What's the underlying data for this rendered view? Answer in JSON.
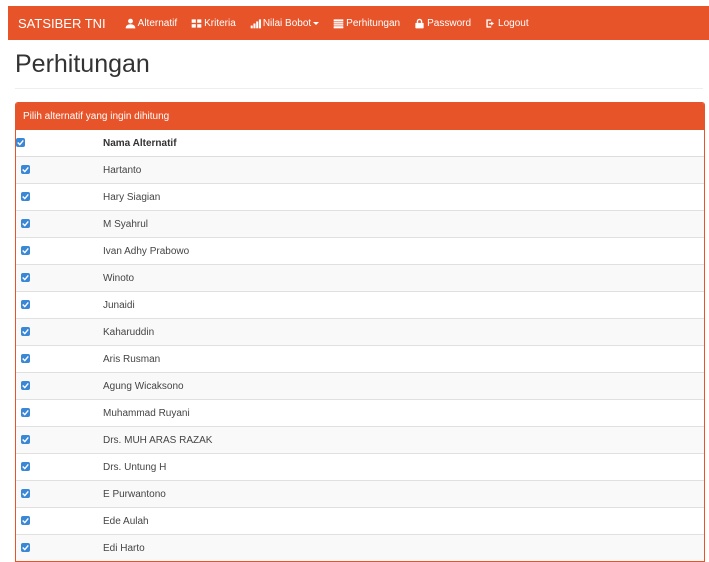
{
  "navbar": {
    "brand": "SATSIBER TNI",
    "items": [
      {
        "label": "Alternatif",
        "icon": "user-icon"
      },
      {
        "label": "Kriteria",
        "icon": "th-large-icon"
      },
      {
        "label": "Nilai Bobot",
        "icon": "signal-icon",
        "dropdown": true
      },
      {
        "label": "Perhitungan",
        "icon": "calendar-icon"
      },
      {
        "label": "Password",
        "icon": "lock-icon"
      },
      {
        "label": "Logout",
        "icon": "logout-icon"
      }
    ]
  },
  "page": {
    "title": "Perhitungan"
  },
  "panel": {
    "heading": "Pilih alternatif yang ingin dihitung",
    "column_header": "Nama Alternatif",
    "header_checked": true,
    "rows": [
      {
        "name": "Hartanto",
        "checked": true
      },
      {
        "name": "Hary Siagian",
        "checked": true
      },
      {
        "name": "M Syahrul",
        "checked": true
      },
      {
        "name": "Ivan Adhy Prabowo",
        "checked": true
      },
      {
        "name": "Winoto",
        "checked": true
      },
      {
        "name": "Junaidi",
        "checked": true
      },
      {
        "name": "Kaharuddin",
        "checked": true
      },
      {
        "name": "Aris Rusman",
        "checked": true
      },
      {
        "name": "Agung Wicaksono",
        "checked": true
      },
      {
        "name": "Muhammad Ruyani",
        "checked": true
      },
      {
        "name": "Drs. MUH ARAS RAZAK",
        "checked": true
      },
      {
        "name": "Drs. Untung H",
        "checked": true
      },
      {
        "name": "E Purwantono",
        "checked": true
      },
      {
        "name": "Ede Aulah",
        "checked": true
      },
      {
        "name": "Edi Harto",
        "checked": true
      }
    ]
  },
  "colors": {
    "accent": "#e8542a",
    "checkbox": "#3a87d6"
  }
}
